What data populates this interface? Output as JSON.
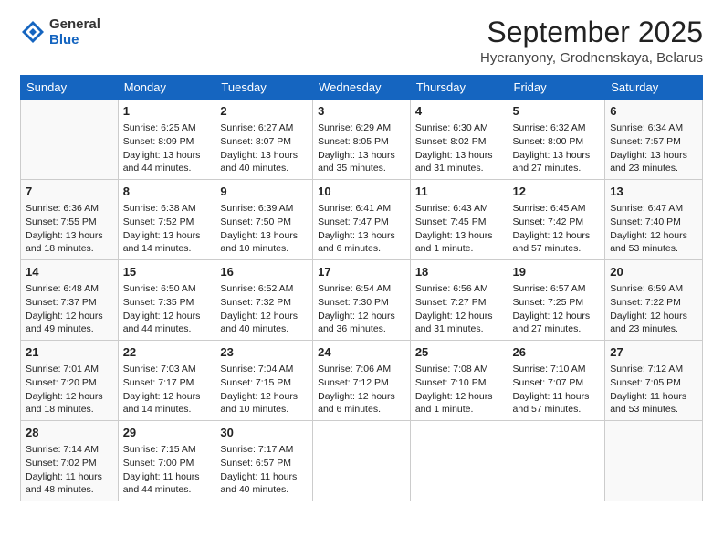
{
  "header": {
    "logo_general": "General",
    "logo_blue": "Blue",
    "month_title": "September 2025",
    "location": "Hyeranyony, Grodnenskaya, Belarus"
  },
  "days_of_week": [
    "Sunday",
    "Monday",
    "Tuesday",
    "Wednesday",
    "Thursday",
    "Friday",
    "Saturday"
  ],
  "weeks": [
    [
      {
        "date": "",
        "sunrise": "",
        "sunset": "",
        "daylight": "",
        "empty": true
      },
      {
        "date": "1",
        "sunrise": "Sunrise: 6:25 AM",
        "sunset": "Sunset: 8:09 PM",
        "daylight": "Daylight: 13 hours and 44 minutes."
      },
      {
        "date": "2",
        "sunrise": "Sunrise: 6:27 AM",
        "sunset": "Sunset: 8:07 PM",
        "daylight": "Daylight: 13 hours and 40 minutes."
      },
      {
        "date": "3",
        "sunrise": "Sunrise: 6:29 AM",
        "sunset": "Sunset: 8:05 PM",
        "daylight": "Daylight: 13 hours and 35 minutes."
      },
      {
        "date": "4",
        "sunrise": "Sunrise: 6:30 AM",
        "sunset": "Sunset: 8:02 PM",
        "daylight": "Daylight: 13 hours and 31 minutes."
      },
      {
        "date": "5",
        "sunrise": "Sunrise: 6:32 AM",
        "sunset": "Sunset: 8:00 PM",
        "daylight": "Daylight: 13 hours and 27 minutes."
      },
      {
        "date": "6",
        "sunrise": "Sunrise: 6:34 AM",
        "sunset": "Sunset: 7:57 PM",
        "daylight": "Daylight: 13 hours and 23 minutes."
      }
    ],
    [
      {
        "date": "7",
        "sunrise": "Sunrise: 6:36 AM",
        "sunset": "Sunset: 7:55 PM",
        "daylight": "Daylight: 13 hours and 18 minutes."
      },
      {
        "date": "8",
        "sunrise": "Sunrise: 6:38 AM",
        "sunset": "Sunset: 7:52 PM",
        "daylight": "Daylight: 13 hours and 14 minutes."
      },
      {
        "date": "9",
        "sunrise": "Sunrise: 6:39 AM",
        "sunset": "Sunset: 7:50 PM",
        "daylight": "Daylight: 13 hours and 10 minutes."
      },
      {
        "date": "10",
        "sunrise": "Sunrise: 6:41 AM",
        "sunset": "Sunset: 7:47 PM",
        "daylight": "Daylight: 13 hours and 6 minutes."
      },
      {
        "date": "11",
        "sunrise": "Sunrise: 6:43 AM",
        "sunset": "Sunset: 7:45 PM",
        "daylight": "Daylight: 13 hours and 1 minute."
      },
      {
        "date": "12",
        "sunrise": "Sunrise: 6:45 AM",
        "sunset": "Sunset: 7:42 PM",
        "daylight": "Daylight: 12 hours and 57 minutes."
      },
      {
        "date": "13",
        "sunrise": "Sunrise: 6:47 AM",
        "sunset": "Sunset: 7:40 PM",
        "daylight": "Daylight: 12 hours and 53 minutes."
      }
    ],
    [
      {
        "date": "14",
        "sunrise": "Sunrise: 6:48 AM",
        "sunset": "Sunset: 7:37 PM",
        "daylight": "Daylight: 12 hours and 49 minutes."
      },
      {
        "date": "15",
        "sunrise": "Sunrise: 6:50 AM",
        "sunset": "Sunset: 7:35 PM",
        "daylight": "Daylight: 12 hours and 44 minutes."
      },
      {
        "date": "16",
        "sunrise": "Sunrise: 6:52 AM",
        "sunset": "Sunset: 7:32 PM",
        "daylight": "Daylight: 12 hours and 40 minutes."
      },
      {
        "date": "17",
        "sunrise": "Sunrise: 6:54 AM",
        "sunset": "Sunset: 7:30 PM",
        "daylight": "Daylight: 12 hours and 36 minutes."
      },
      {
        "date": "18",
        "sunrise": "Sunrise: 6:56 AM",
        "sunset": "Sunset: 7:27 PM",
        "daylight": "Daylight: 12 hours and 31 minutes."
      },
      {
        "date": "19",
        "sunrise": "Sunrise: 6:57 AM",
        "sunset": "Sunset: 7:25 PM",
        "daylight": "Daylight: 12 hours and 27 minutes."
      },
      {
        "date": "20",
        "sunrise": "Sunrise: 6:59 AM",
        "sunset": "Sunset: 7:22 PM",
        "daylight": "Daylight: 12 hours and 23 minutes."
      }
    ],
    [
      {
        "date": "21",
        "sunrise": "Sunrise: 7:01 AM",
        "sunset": "Sunset: 7:20 PM",
        "daylight": "Daylight: 12 hours and 18 minutes."
      },
      {
        "date": "22",
        "sunrise": "Sunrise: 7:03 AM",
        "sunset": "Sunset: 7:17 PM",
        "daylight": "Daylight: 12 hours and 14 minutes."
      },
      {
        "date": "23",
        "sunrise": "Sunrise: 7:04 AM",
        "sunset": "Sunset: 7:15 PM",
        "daylight": "Daylight: 12 hours and 10 minutes."
      },
      {
        "date": "24",
        "sunrise": "Sunrise: 7:06 AM",
        "sunset": "Sunset: 7:12 PM",
        "daylight": "Daylight: 12 hours and 6 minutes."
      },
      {
        "date": "25",
        "sunrise": "Sunrise: 7:08 AM",
        "sunset": "Sunset: 7:10 PM",
        "daylight": "Daylight: 12 hours and 1 minute."
      },
      {
        "date": "26",
        "sunrise": "Sunrise: 7:10 AM",
        "sunset": "Sunset: 7:07 PM",
        "daylight": "Daylight: 11 hours and 57 minutes."
      },
      {
        "date": "27",
        "sunrise": "Sunrise: 7:12 AM",
        "sunset": "Sunset: 7:05 PM",
        "daylight": "Daylight: 11 hours and 53 minutes."
      }
    ],
    [
      {
        "date": "28",
        "sunrise": "Sunrise: 7:14 AM",
        "sunset": "Sunset: 7:02 PM",
        "daylight": "Daylight: 11 hours and 48 minutes."
      },
      {
        "date": "29",
        "sunrise": "Sunrise: 7:15 AM",
        "sunset": "Sunset: 7:00 PM",
        "daylight": "Daylight: 11 hours and 44 minutes."
      },
      {
        "date": "30",
        "sunrise": "Sunrise: 7:17 AM",
        "sunset": "Sunset: 6:57 PM",
        "daylight": "Daylight: 11 hours and 40 minutes."
      },
      {
        "date": "",
        "sunrise": "",
        "sunset": "",
        "daylight": "",
        "empty": true
      },
      {
        "date": "",
        "sunrise": "",
        "sunset": "",
        "daylight": "",
        "empty": true
      },
      {
        "date": "",
        "sunrise": "",
        "sunset": "",
        "daylight": "",
        "empty": true
      },
      {
        "date": "",
        "sunrise": "",
        "sunset": "",
        "daylight": "",
        "empty": true
      }
    ]
  ]
}
